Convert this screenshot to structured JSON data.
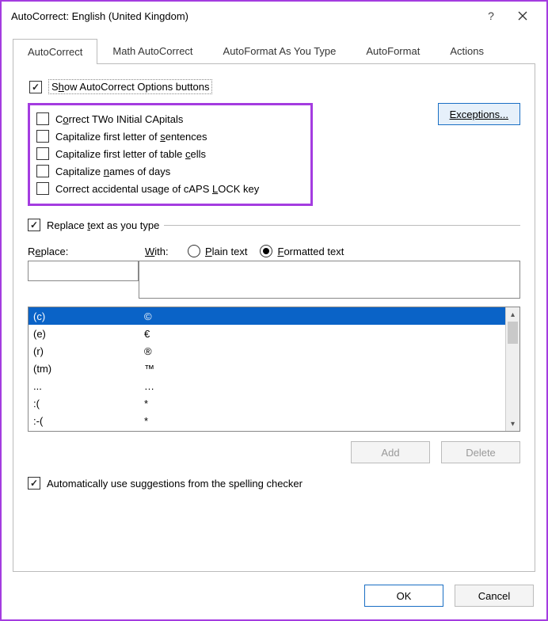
{
  "window": {
    "title": "AutoCorrect: English (United Kingdom)"
  },
  "tabs": [
    {
      "label": "AutoCorrect",
      "active": true
    },
    {
      "label": "Math AutoCorrect",
      "active": false
    },
    {
      "label": "AutoFormat As You Type",
      "active": false
    },
    {
      "label": "AutoFormat",
      "active": false
    },
    {
      "label": "Actions",
      "active": false
    }
  ],
  "show_opts": {
    "pre": "S",
    "mid": "h",
    "post": "ow AutoCorrect Options buttons",
    "checked": true
  },
  "caps_options": [
    {
      "pre": "Correct TWo INitial CApitals",
      "checked": false,
      "u": "O",
      "uIndex": 1
    },
    {
      "pre": "Capitalize first letter of sentences",
      "checked": false,
      "u": "s",
      "uIndex": 27
    },
    {
      "pre": "Capitalize first letter of table cells",
      "checked": false,
      "u": "c",
      "uIndex": 33
    },
    {
      "pre": "Capitalize names of days",
      "checked": false,
      "u": "n",
      "uIndex": 11
    },
    {
      "pre": "Correct accidental usage of cAPS LOCK key",
      "checked": false,
      "u": "L",
      "uIndex": 33
    }
  ],
  "exceptions_label": "Exceptions...",
  "replace_check": {
    "pre": "Replace ",
    "u": "t",
    "post": "ext as you type",
    "checked": true
  },
  "lbl_replace": {
    "pre": "R",
    "u": "e",
    "post": "place:"
  },
  "lbl_with": {
    "u": "W",
    "post": "ith:"
  },
  "radio_plain": {
    "u": "P",
    "post": "lain text",
    "checked": false
  },
  "radio_formatted": {
    "u": "F",
    "post": "ormatted text",
    "checked": true
  },
  "entries": [
    {
      "replace": "(c)",
      "with": "©",
      "selected": true
    },
    {
      "replace": "(e)",
      "with": "€",
      "selected": false
    },
    {
      "replace": "(r)",
      "with": "®",
      "selected": false
    },
    {
      "replace": "(tm)",
      "with": "™",
      "selected": false
    },
    {
      "replace": "...",
      "with": "…",
      "selected": false
    },
    {
      "replace": ":(",
      "with": "*",
      "selected": false
    },
    {
      "replace": ":-(",
      "with": "*",
      "selected": false
    }
  ],
  "btn_add": "Add",
  "btn_delete": "Delete",
  "sugg_check": {
    "label": "Automatically use suggestions from the spelling checker",
    "checked": true
  },
  "btn_ok": "OK",
  "btn_cancel": "Cancel"
}
